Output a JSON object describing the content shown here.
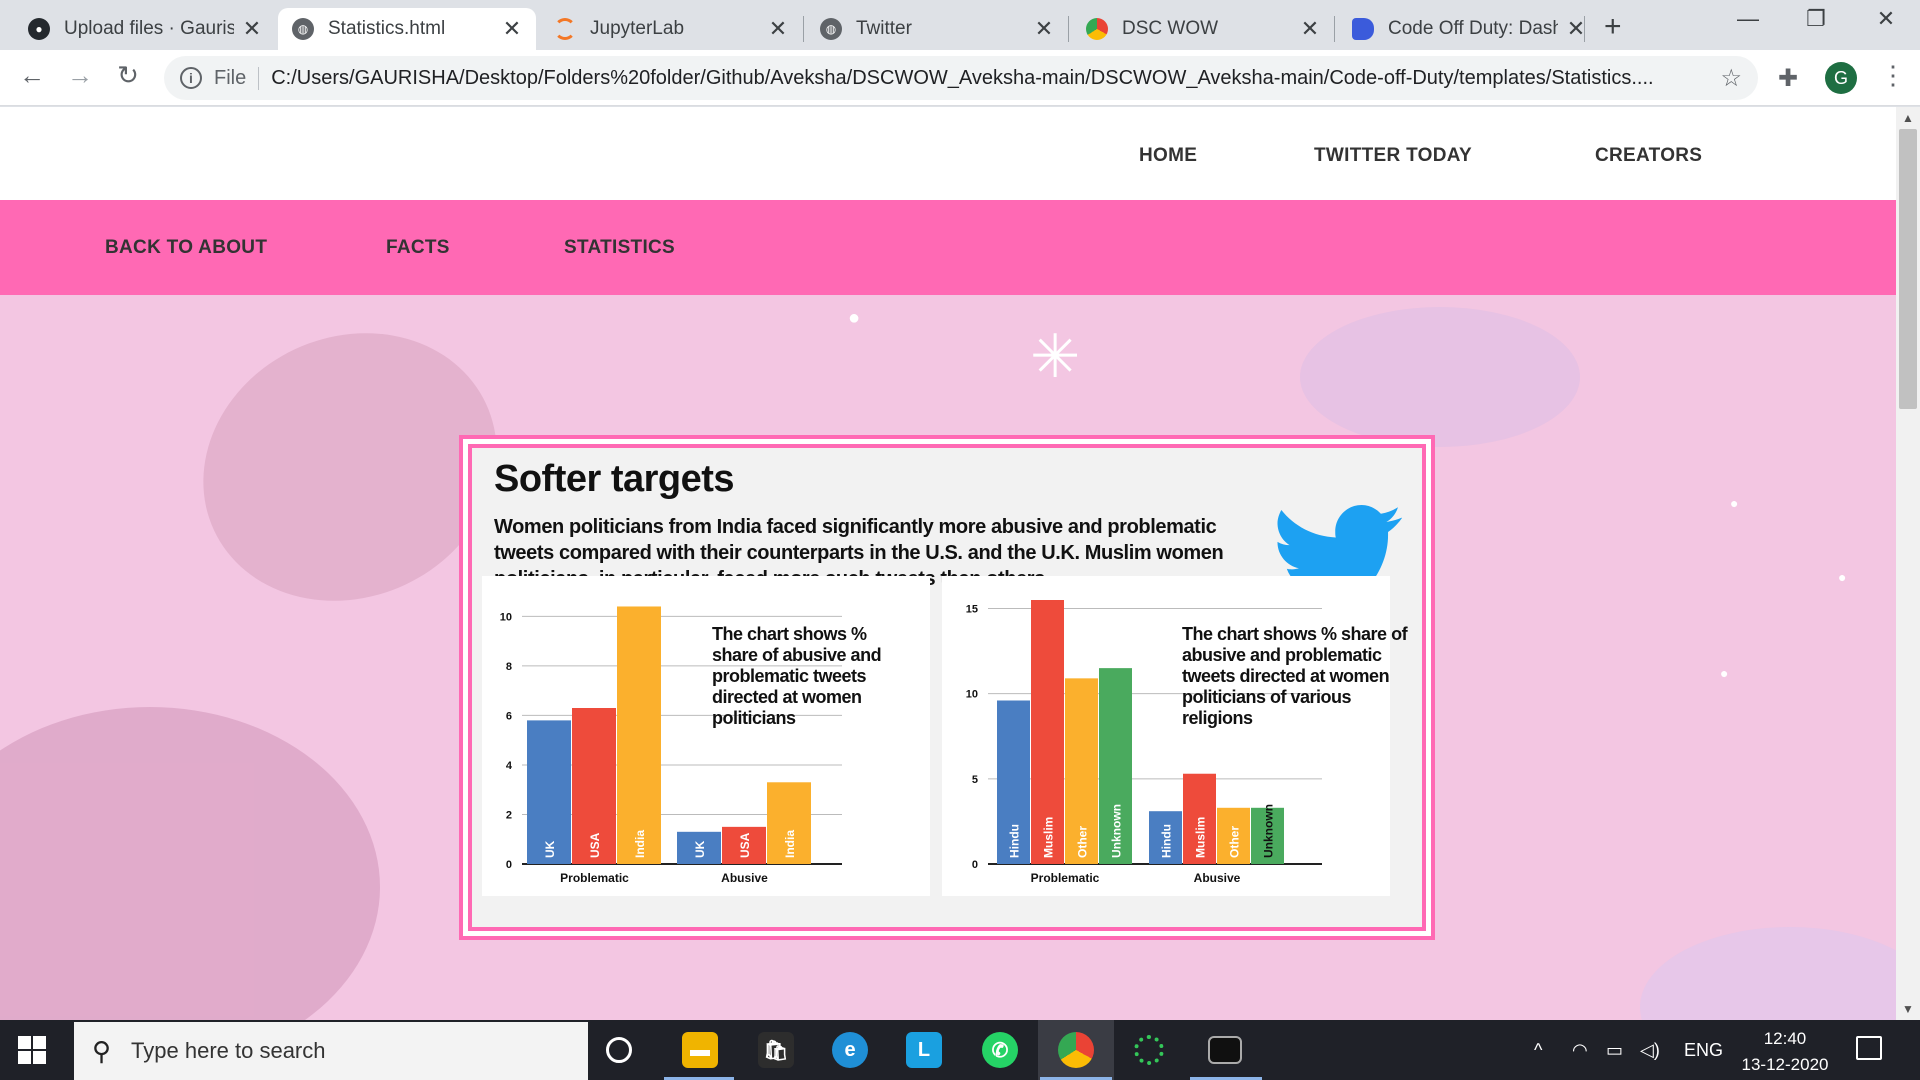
{
  "browser": {
    "tabs": [
      {
        "title": "Upload files · Gaurish",
        "icon": "github-icon",
        "active": false
      },
      {
        "title": "Statistics.html",
        "icon": "globe-icon",
        "active": true
      },
      {
        "title": "JupyterLab",
        "icon": "jupyter-icon",
        "active": false
      },
      {
        "title": "Twitter",
        "icon": "globe-icon",
        "active": false
      },
      {
        "title": "DSC WOW",
        "icon": "chrome-icon",
        "active": false
      },
      {
        "title": "Code Off Duty: Dash",
        "icon": "docs-icon",
        "active": false
      }
    ],
    "new_tab": "+",
    "close_glyph": "✕",
    "file_label": "File",
    "url": "C:/Users/GAURISHA/Desktop/Folders%20folder/Github/Aveksha/DSCWOW_Aveksha-main/DSCWOW_Aveksha-main/Code-off-Duty/templates/Statistics....",
    "profile_initial": "G"
  },
  "site": {
    "nav": [
      "HOME",
      "TWITTER TODAY",
      "CREATORS"
    ],
    "subnav": [
      "BACK TO ABOUT",
      "FACTS",
      "STATISTICS"
    ],
    "colors": {
      "accent": "#ff69b4",
      "background": "#f3c6e2"
    }
  },
  "infographic": {
    "title": "Softer targets",
    "subtitle": "Women politicians from India faced significantly more abusive and problematic tweets compared with their counterparts in the U.S. and the U.K. Muslim women politicians, in particular, faced more such tweets than others",
    "note_left": "The chart shows % share of abusive and problematic tweets directed at women politicians",
    "note_right": "The chart shows % share of abusive and problematic tweets directed at women politicians of various religions"
  },
  "chart_data": [
    {
      "type": "bar",
      "categories": [
        "Problematic",
        "Abusive"
      ],
      "series": [
        {
          "name": "UK",
          "values": [
            5.8,
            1.3
          ],
          "color": "#4a7ec2"
        },
        {
          "name": "USA",
          "values": [
            6.3,
            1.5
          ],
          "color": "#ee4b3b"
        },
        {
          "name": "India",
          "values": [
            10.4,
            3.3
          ],
          "color": "#fbb02d"
        }
      ],
      "ylim": [
        0,
        10.5
      ],
      "yticks": [
        0,
        2,
        4,
        6,
        8,
        10
      ],
      "grid": true
    },
    {
      "type": "bar",
      "categories": [
        "Problematic",
        "Abusive"
      ],
      "series": [
        {
          "name": "Hindu",
          "values": [
            9.6,
            3.1
          ],
          "color": "#4a7ec2"
        },
        {
          "name": "Muslim",
          "values": [
            15.5,
            5.3
          ],
          "color": "#ee4b3b"
        },
        {
          "name": "Other",
          "values": [
            10.9,
            3.3
          ],
          "color": "#fbb02d"
        },
        {
          "name": "Unknown",
          "values": [
            11.5,
            3.3
          ],
          "color": "#4aaa5e"
        }
      ],
      "ylim": [
        0,
        15.5
      ],
      "yticks": [
        0,
        5,
        10,
        15
      ],
      "grid": true
    }
  ],
  "taskbar": {
    "search_placeholder": "Type here to search",
    "lang": "ENG",
    "time": "12:40",
    "date": "13-12-2020"
  }
}
